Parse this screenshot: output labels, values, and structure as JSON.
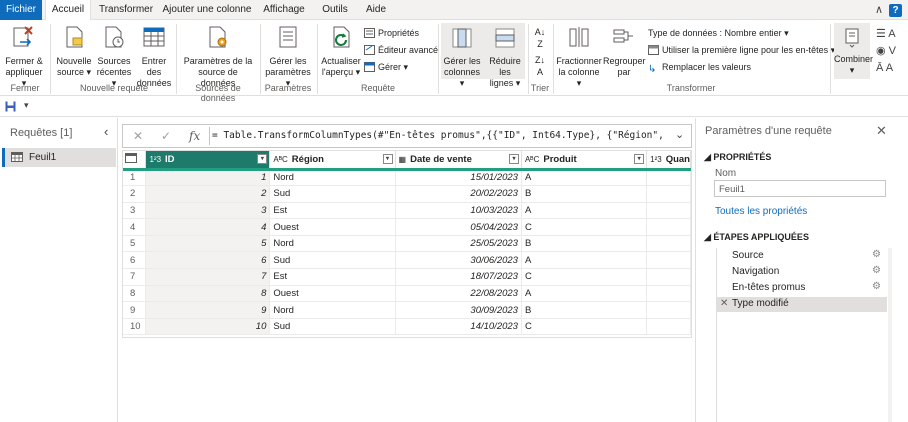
{
  "tabs": [
    "Fichier",
    "Accueil",
    "Transformer",
    "Ajouter une colonne",
    "Affichage",
    "Outils",
    "Aide"
  ],
  "ribbon": {
    "fermer": {
      "btn": "Fermer &",
      "btn2": "appliquer",
      "group": "Fermer"
    },
    "nouvelle": {
      "b1": "Nouvelle",
      "b1b": "source",
      "b2": "Sources",
      "b2b": "récentes",
      "b3": "Entrer des",
      "b3b": "données",
      "group": "Nouvelle requête"
    },
    "sources": {
      "b1": "Paramètres de la",
      "b1b": "source de données",
      "group": "Sources de données"
    },
    "params": {
      "b1": "Gérer les",
      "b1b": "paramètres",
      "group": "Paramètres"
    },
    "requete": {
      "b1": "Actualiser",
      "b1b": "l'aperçu",
      "s1": "Propriétés",
      "s2": "Éditeur avancé",
      "s3": "Gérer",
      "group": "Requête"
    },
    "colonnes": {
      "b1": "Gérer les",
      "b1b": "colonnes",
      "b2": "Réduire les",
      "b2b": "lignes"
    },
    "trier": {
      "group": "Trier"
    },
    "transformer": {
      "b1": "Fractionner",
      "b1b": "la colonne",
      "b2": "Regrouper",
      "b2b": "par",
      "s1": "Type de données : Nombre entier",
      "s2": "Utiliser la première ligne pour les en-têtes",
      "s3": "Remplacer les valeurs",
      "group": "Transformer"
    },
    "combiner": {
      "b1": "Combiner"
    }
  },
  "left": {
    "title": "Requêtes [1]",
    "query": "Feuil1"
  },
  "formula": {
    "fx": "fx",
    "text": "= Table.TransformColumnTypes(#\"En-têtes promus\",{{\"ID\", Int64.Type}, {\"Région\", type"
  },
  "grid": {
    "headers": [
      {
        "type": "1²3",
        "name": "ID"
      },
      {
        "type": "AᴮC",
        "name": "Région"
      },
      {
        "type": "▦",
        "name": "Date de vente"
      },
      {
        "type": "AᴮC",
        "name": "Produit"
      },
      {
        "type": "1²3",
        "name": "Quan"
      }
    ],
    "rows": [
      [
        "1",
        "1",
        "Nord",
        "15/01/2023",
        "A"
      ],
      [
        "2",
        "2",
        "Sud",
        "20/02/2023",
        "B"
      ],
      [
        "3",
        "3",
        "Est",
        "10/03/2023",
        "A"
      ],
      [
        "4",
        "4",
        "Ouest",
        "05/04/2023",
        "C"
      ],
      [
        "5",
        "5",
        "Nord",
        "25/05/2023",
        "B"
      ],
      [
        "6",
        "6",
        "Sud",
        "30/06/2023",
        "A"
      ],
      [
        "7",
        "7",
        "Est",
        "18/07/2023",
        "C"
      ],
      [
        "8",
        "8",
        "Ouest",
        "22/08/2023",
        "A"
      ],
      [
        "9",
        "9",
        "Nord",
        "30/09/2023",
        "B"
      ],
      [
        "10",
        "10",
        "Sud",
        "14/10/2023",
        "C"
      ]
    ]
  },
  "right": {
    "title": "Paramètres d'une requête",
    "props_header": "PROPRIÉTÉS",
    "name_label": "Nom",
    "name_value": "Feuil1",
    "all_props": "Toutes les propriétés",
    "steps_header": "ÉTAPES APPLIQUÉES",
    "steps": [
      "Source",
      "Navigation",
      "En-têtes promus",
      "Type modifié"
    ]
  },
  "colors": {
    "accent": "#0f6cbd",
    "header_teal": "#1e7a6a",
    "underline": "#20a080"
  }
}
